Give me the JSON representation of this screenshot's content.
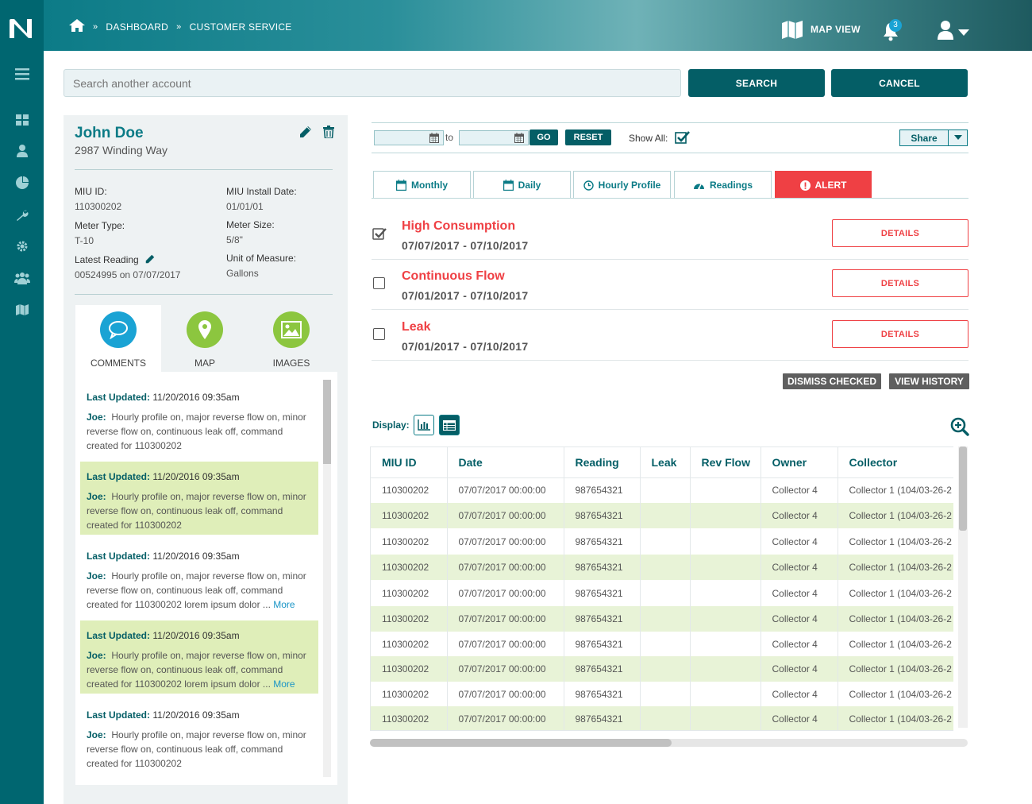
{
  "breadcrumb": {
    "items": [
      "DASHBOARD",
      "CUSTOMER SERVICE"
    ]
  },
  "header": {
    "map_view_label": "MAP VIEW",
    "notification_count": "3"
  },
  "search": {
    "placeholder": "Search another account",
    "search_label": "SEARCH",
    "cancel_label": "CANCEL"
  },
  "customer": {
    "name": "John Doe",
    "address": "2987 Winding Way",
    "fields": {
      "miu_id": {
        "label": "MIU ID:",
        "value": "110300202"
      },
      "miu_install_date": {
        "label": "MIU Install Date:",
        "value": "01/01/01"
      },
      "meter_type": {
        "label": "Meter Type:",
        "value": "T-10"
      },
      "meter_size": {
        "label": "Meter Size:",
        "value": "5/8\""
      },
      "latest_reading": {
        "label": "Latest Reading",
        "value": "00524995 on 07/07/2017"
      },
      "unit_of_measure": {
        "label": "Unit of Measure:",
        "value": "Gallons"
      }
    },
    "tabs": [
      "COMMENTS",
      "MAP",
      "IMAGES"
    ]
  },
  "comments": [
    {
      "updated_label": "Last Updated:",
      "date": "11/20/2016  09:35am",
      "author": "Joe:",
      "text": "Hourly profile on, major reverse flow on, minor reverse flow on, continuous leak off, command created for 110300202",
      "more": ""
    },
    {
      "updated_label": "Last Updated:",
      "date": "11/20/2016  09:35am",
      "author": "Joe:",
      "text": "Hourly profile on, major reverse flow on, minor reverse flow on, continuous leak off, command created for 110300202",
      "more": ""
    },
    {
      "updated_label": "Last Updated:",
      "date": "11/20/2016  09:35am",
      "author": "Joe:",
      "text": "Hourly profile on, major reverse flow on, minor reverse flow on, continuous leak off, command created for 110300202 lorem ipsum dolor ...",
      "more": "More"
    },
    {
      "updated_label": "Last Updated:",
      "date": "11/20/2016  09:35am",
      "author": "Joe:",
      "text": "Hourly profile on, major reverse flow on, minor reverse flow on, continuous leak off, command created for 110300202 lorem ipsum dolor ...",
      "more": "More"
    },
    {
      "updated_label": "Last Updated:",
      "date": "11/20/2016  09:35am",
      "author": "Joe:",
      "text": "Hourly profile on, major reverse flow on, minor reverse flow on, continuous leak off, command created for 110300202",
      "more": ""
    }
  ],
  "filters": {
    "to_label": "to",
    "go_label": "GO",
    "reset_label": "RESET",
    "show_all_label": "Show All:",
    "share_label": "Share"
  },
  "view_tabs": [
    "Monthly",
    "Daily",
    "Hourly Profile",
    "Readings",
    "ALERT"
  ],
  "alerts": [
    {
      "title": "High Consumption",
      "dates": "07/07/2017 - 07/10/2017",
      "checked": true,
      "action": "DETAILS"
    },
    {
      "title": "Continuous Flow",
      "dates": "07/01/2017 - 07/10/2017",
      "checked": false,
      "action": "DETAILS"
    },
    {
      "title": "Leak",
      "dates": "07/01/2017 - 07/10/2017",
      "checked": false,
      "action": "DETAILS"
    }
  ],
  "alert_actions": {
    "dismiss_label": "DISMISS CHECKED",
    "history_label": "VIEW HISTORY"
  },
  "display_label": "Display:",
  "table": {
    "columns": [
      "MIU ID",
      "Date",
      "Reading",
      "Leak",
      "Rev Flow",
      "Owner",
      "Collector"
    ],
    "rows": [
      [
        "110300202",
        "07/07/2017  00:00:00",
        "987654321",
        "",
        "",
        "Collector 4",
        "Collector 1 (104/03-26-2"
      ],
      [
        "110300202",
        "07/07/2017  00:00:00",
        "987654321",
        "",
        "",
        "Collector 4",
        "Collector 1 (104/03-26-2"
      ],
      [
        "110300202",
        "07/07/2017  00:00:00",
        "987654321",
        "",
        "",
        "Collector 4",
        "Collector 1 (104/03-26-2"
      ],
      [
        "110300202",
        "07/07/2017  00:00:00",
        "987654321",
        "",
        "",
        "Collector 4",
        "Collector 1 (104/03-26-2"
      ],
      [
        "110300202",
        "07/07/2017  00:00:00",
        "987654321",
        "",
        "",
        "Collector 4",
        "Collector 1 (104/03-26-2"
      ],
      [
        "110300202",
        "07/07/2017  00:00:00",
        "987654321",
        "",
        "",
        "Collector 4",
        "Collector 1 (104/03-26-2"
      ],
      [
        "110300202",
        "07/07/2017  00:00:00",
        "987654321",
        "",
        "",
        "Collector 4",
        "Collector 1 (104/03-26-2"
      ],
      [
        "110300202",
        "07/07/2017  00:00:00",
        "987654321",
        "",
        "",
        "Collector 4",
        "Collector 1 (104/03-26-2"
      ],
      [
        "110300202",
        "07/07/2017  00:00:00",
        "987654321",
        "",
        "",
        "Collector 4",
        "Collector 1 (104/03-26-2"
      ],
      [
        "110300202",
        "07/07/2017  00:00:00",
        "987654321",
        "",
        "",
        "Collector 4",
        "Collector 1 (104/03-26-2"
      ]
    ]
  },
  "colors": {
    "brand": "#006670",
    "dark_button": "#045e66",
    "alert": "#ef4044",
    "row_highlight": "#e8f3d7",
    "comment_highlight": "#dfeeb9",
    "accent_blue": "#1aa3d4",
    "green_circle": "#8cc63f"
  }
}
